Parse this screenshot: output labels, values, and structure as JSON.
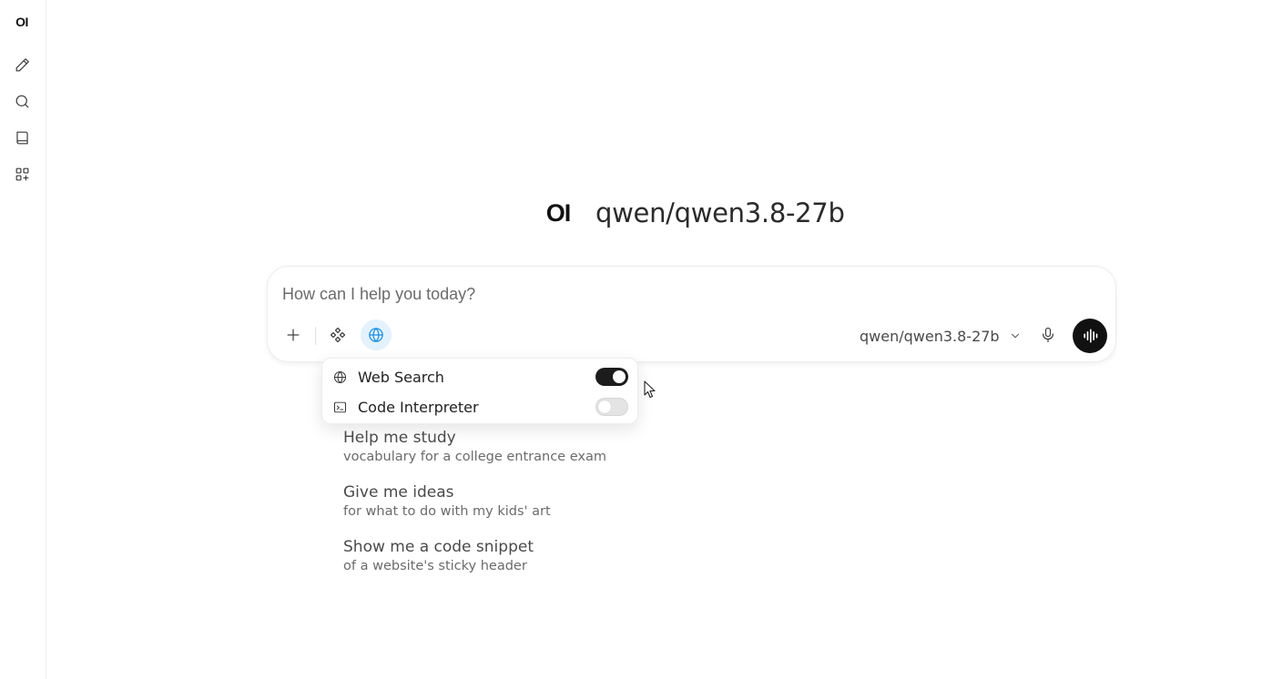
{
  "app": {
    "logo_text": "OI"
  },
  "sidebar": {
    "items": [
      {
        "name": "new-chat",
        "icon": "pencil-icon"
      },
      {
        "name": "search",
        "icon": "search-icon"
      },
      {
        "name": "notes",
        "icon": "book-icon"
      },
      {
        "name": "workspace",
        "icon": "grid-plus-icon"
      }
    ]
  },
  "hero": {
    "logo_text": "OI",
    "model_name": "qwen/qwen3.8-27b"
  },
  "composer": {
    "placeholder": "How can I help you today?",
    "value": "",
    "selected_model": "qwen/qwen3.8-27b",
    "web_search_active": true
  },
  "tools_menu": {
    "items": [
      {
        "label": "Web Search",
        "icon": "globe-icon",
        "enabled": true
      },
      {
        "label": "Code Interpreter",
        "icon": "terminal-icon",
        "enabled": false
      }
    ]
  },
  "suggestions": [
    {
      "title": "Help me study",
      "subtitle": "vocabulary for a college entrance exam"
    },
    {
      "title": "Give me ideas",
      "subtitle": "for what to do with my kids' art"
    },
    {
      "title": "Show me a code snippet",
      "subtitle": "of a website's sticky header"
    }
  ],
  "colors": {
    "accent": "#1a8ee0",
    "accent_bg": "#e3f2fc",
    "toggle_on": "#1c1c1c",
    "toggle_off": "#e4e4e4"
  }
}
